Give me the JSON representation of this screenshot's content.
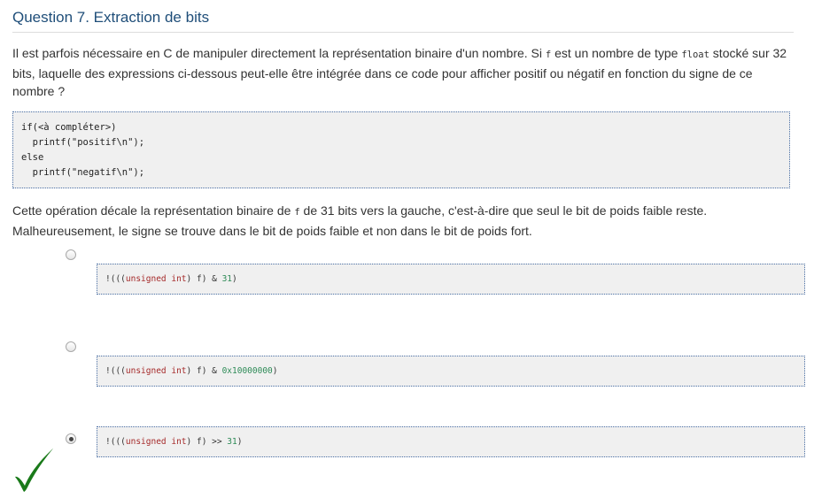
{
  "question": {
    "title": "Question 7. Extraction de bits",
    "text_part1": "Il est parfois nécessaire en C de manipuler directement la représentation binaire d'un nombre. Si ",
    "var_f": "f",
    "text_part2": " est un nombre de type ",
    "type_float": "float",
    "text_part3": " stocké sur 32 bits, laquelle des expressions ci-dessous peut-elle être intégrée dans ce code pour afficher positif ou négatif en fonction du signe de ce nombre ?",
    "code": "if(<à compléter>)\n  printf(\"positif\\n\");\nelse\n  printf(\"negatif\\n\");"
  },
  "feedback": {
    "text_part1": "Cette opération décale la représentation binaire de ",
    "var_f": "f",
    "text_part2": " de 31 bits vers la gauche, c'est-à-dire que seul le bit de poids faible reste. Malheureusement, le signe se trouve dans le bit de poids faible et non dans le bit de poids fort."
  },
  "options": [
    {
      "prefix": "!(((",
      "keyword": "unsigned int",
      "middle": ") f) & ",
      "number": "31",
      "suffix": ")",
      "selected": false
    },
    {
      "prefix": "!(((",
      "keyword": "unsigned int",
      "middle": ") f) & ",
      "number": "0x10000000",
      "suffix": ")",
      "selected": false
    },
    {
      "prefix": "!(((",
      "keyword": "unsigned int",
      "middle": ") f) >> ",
      "number": "31",
      "suffix": ")",
      "selected": true
    }
  ],
  "colors": {
    "title": "#1f4e79",
    "keyword": "#a52a2a",
    "number": "#2e8b57",
    "checkmark": "#1a7a1a"
  },
  "icons": {
    "result": "checkmark-icon"
  }
}
